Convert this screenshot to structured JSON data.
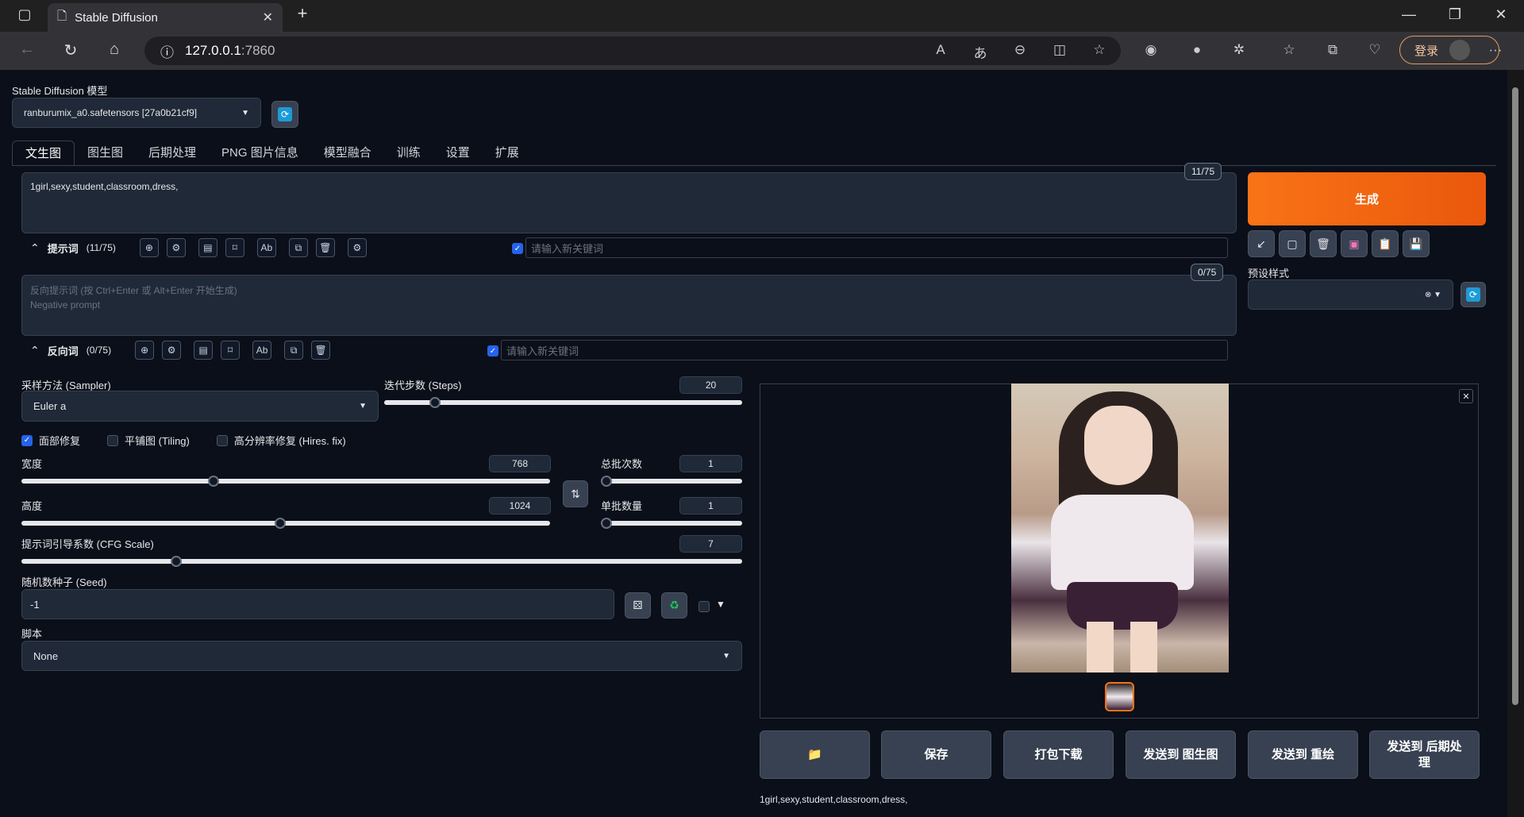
{
  "browser": {
    "tab_title": "Stable Diffusion",
    "url_host": "127.0.0.1",
    "url_port": ":7860",
    "login_label": "登录"
  },
  "model": {
    "label": "Stable Diffusion 模型",
    "selected": "ranburumix_a0.safetensors [27a0b21cf9]"
  },
  "tabs": [
    "文生图",
    "图生图",
    "后期处理",
    "PNG 图片信息",
    "模型融合",
    "训练",
    "设置",
    "扩展"
  ],
  "prompt": {
    "value": "1girl,sexy,student,classroom,dress,",
    "counter": "11/75",
    "section_label": "提示词",
    "section_count": "(11/75)",
    "keyword_placeholder": "请输入新关键词"
  },
  "negative": {
    "placeholder_line1": "反向提示词 (按 Ctrl+Enter 或 Alt+Enter 开始生成)",
    "placeholder_line2": "Negative prompt",
    "counter": "0/75",
    "section_label": "反向词",
    "section_count": "(0/75)",
    "keyword_placeholder": "请输入新关键词"
  },
  "generate_label": "生成",
  "styles_label": "预设样式",
  "sampler": {
    "label": "采样方法 (Sampler)",
    "value": "Euler a"
  },
  "steps": {
    "label": "迭代步数 (Steps)",
    "value": "20",
    "fraction": 0.13
  },
  "options": {
    "face_restore": "面部修复",
    "tiling": "平铺图 (Tiling)",
    "hires": "高分辨率修复 (Hires. fix)"
  },
  "width": {
    "label": "宽度",
    "value": "768",
    "fraction": 0.36
  },
  "height": {
    "label": "高度",
    "value": "1024",
    "fraction": 0.49
  },
  "batch_count": {
    "label": "总批次数",
    "value": "1",
    "fraction": 0.0
  },
  "batch_size": {
    "label": "单批数量",
    "value": "1",
    "fraction": 0.0
  },
  "cfg": {
    "label": "提示词引导系数 (CFG Scale)",
    "value": "7",
    "fraction": 0.21
  },
  "seed": {
    "label": "随机数种子 (Seed)",
    "value": "-1"
  },
  "script": {
    "label": "脚本",
    "value": "None"
  },
  "actions": [
    "保存",
    "打包下载",
    "发送到 图生图",
    "发送到 重绘",
    "发送到 后期处理"
  ],
  "output_caption": "1girl,sexy,student,classroom,dress,"
}
